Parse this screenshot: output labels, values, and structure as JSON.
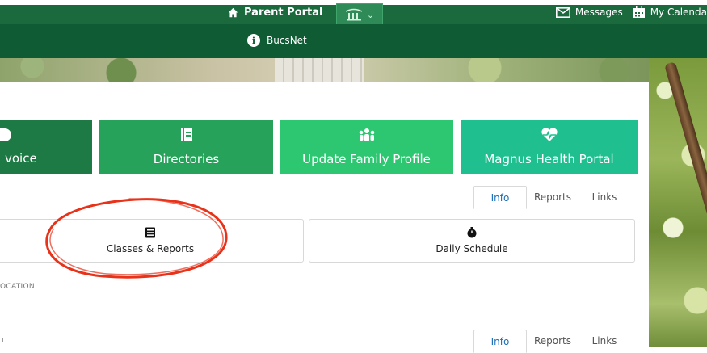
{
  "top_nav": {
    "parent_portal_label": "Parent Portal",
    "logo_tab_chevron": "⌄",
    "messages_label": "Messages",
    "calendar_label": "My Calenda"
  },
  "sub_nav": {
    "bucsnet_label": "BucsNet",
    "info_glyph": "i"
  },
  "tiles": [
    {
      "label": "voice",
      "icon": "invoice-dollar-icon",
      "color": "#1e7a45"
    },
    {
      "label": "Directories",
      "icon": "directory-book-icon",
      "color": "#26a25a"
    },
    {
      "label": "Update Family Profile",
      "icon": "family-icon",
      "color": "#2ec771"
    },
    {
      "label": "Magnus Health Portal",
      "icon": "heart-pulse-icon",
      "color": "#1fbf8f"
    }
  ],
  "tabs_top": {
    "info": "Info",
    "reports": "Reports",
    "links": "Links",
    "active": "Info"
  },
  "cards": [
    {
      "label": "Classes & Reports",
      "icon": "checklist-icon"
    },
    {
      "label": "Daily Schedule",
      "icon": "stopwatch-icon"
    }
  ],
  "section_label": "OCATION",
  "tabs_bottom": {
    "info": "Info",
    "reports": "Reports",
    "links": "Links",
    "active": "Info"
  },
  "colors": {
    "nav_green": "#1b6a3e",
    "subnav_green": "#0f5c34",
    "active_tab_text": "#1d6fb5",
    "annotation_red": "#e8321a"
  }
}
